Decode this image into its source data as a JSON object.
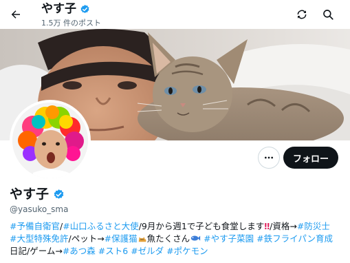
{
  "header": {
    "title": "やす子",
    "posts_count": "1.5万 件のポスト"
  },
  "profile": {
    "display_name": "やす子",
    "handle": "@yasuko_sma",
    "follow_label": "フォロー",
    "verified_color": "#1d9bf0"
  },
  "bio": {
    "line1": {
      "tag1": "#予備自衛官",
      "sep1": "/",
      "tag2": "#山口ふるさと大使",
      "text1": "/9月から週1で子ども食堂します",
      "bang": "‼",
      "text2": "/資格→",
      "tag3": "#防災士"
    },
    "line2": {
      "tag1": "#大型特殊免許",
      "text1": "/ペット→",
      "tag2": "#保護猫",
      "text2": "魚たくさん",
      "tag3": "#やす子菜園",
      "tag4": "#鉄フライパン育成"
    },
    "line3": {
      "text1": "日記/ゲーム→",
      "tag1": "#あつ森",
      "tag2": "#スト6",
      "tag3": "#ゼルダ",
      "tag4": "#ポケモン"
    }
  },
  "icons": {
    "back": "arrow-left-icon",
    "refresh": "refresh-icon",
    "search": "search-icon",
    "more": "more-horizontal-icon",
    "verified": "verified-badge-icon",
    "cat": "cat-emoji-icon",
    "fish": "fish-emoji-icon"
  },
  "colors": {
    "link": "#1d9bf0",
    "text": "#0f1419",
    "secondary": "#536471",
    "follow_bg": "#0f1419"
  }
}
